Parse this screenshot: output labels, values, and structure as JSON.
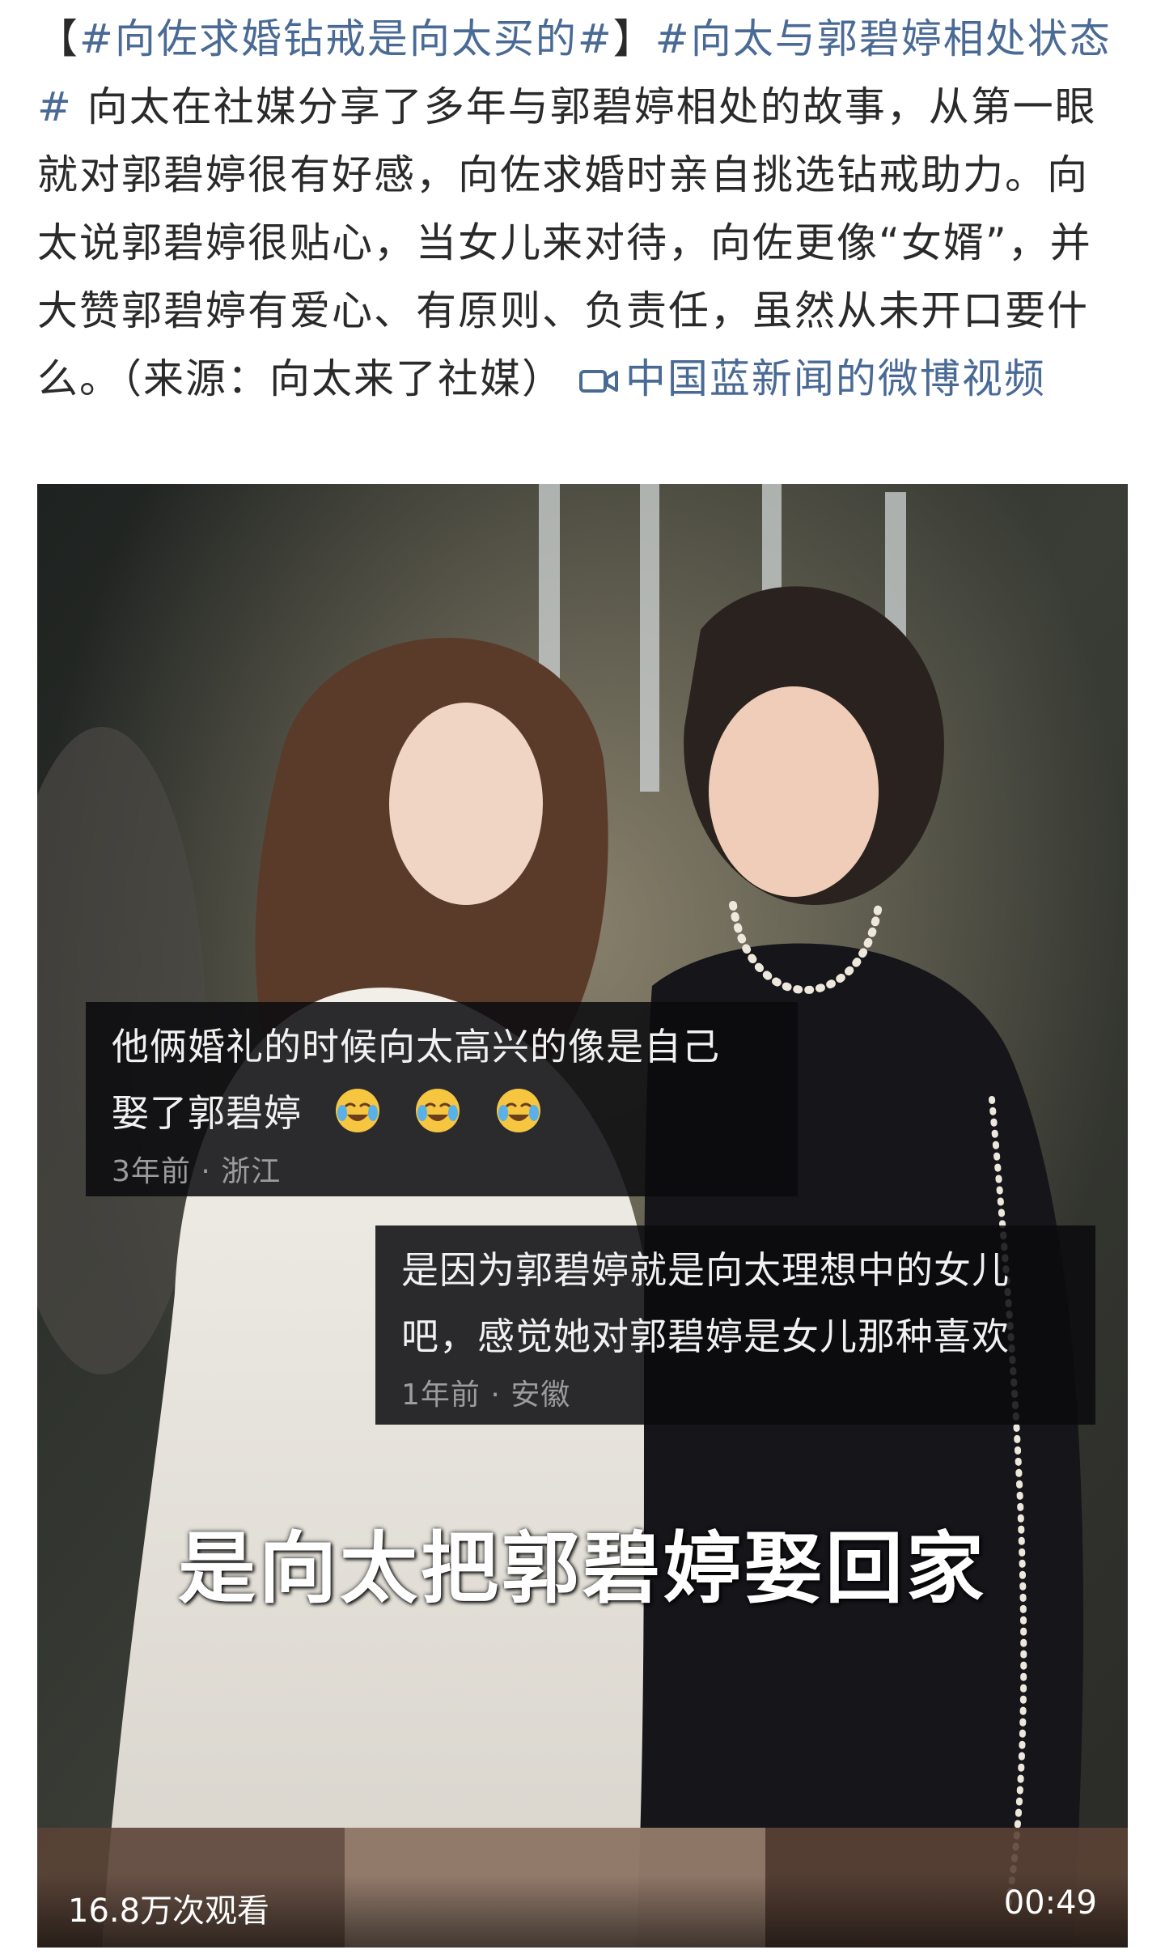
{
  "post": {
    "bracket_open": "【",
    "tag1": "#向佐求婚钻戒是向太买的#",
    "bracket_close": "】",
    "tag2": "#向太与郭碧婷相处状态#",
    "body": " 向太在社媒分享了多年与郭碧婷相处的故事，从第一眼就对郭碧婷很有好感，向佐求婚时亲自挑选钻戒助力。向太说郭碧婷很贴心，当女儿来对待，向佐更像“女婿”，并大赞郭碧婷有爱心、有原则、负责任，虽然从未开口要什么。（来源：向太来了社媒） ",
    "link_icon": "video-camera-icon",
    "link_text": "中国蓝新闻的微博视频"
  },
  "video": {
    "comment1": {
      "line1": "他俩婚礼的时候向太高兴的像是自己",
      "line2": "娶了郭碧婷",
      "emojis": [
        "crying-laughing-emoji",
        "crying-laughing-emoji",
        "crying-laughing-emoji"
      ],
      "meta": "3年前 · 浙江"
    },
    "comment2": {
      "line1": "是因为郭碧婷就是向太理想中的女儿",
      "line2": "吧，感觉她对郭碧婷是女儿那种喜欢",
      "meta": "1年前 · 安徽"
    },
    "subtitle": "是向太把郭碧婷娶回家",
    "views": "16.8万次观看",
    "duration": "00:49"
  },
  "colors": {
    "link": "#4a6a96",
    "text": "#2a2a2a"
  }
}
